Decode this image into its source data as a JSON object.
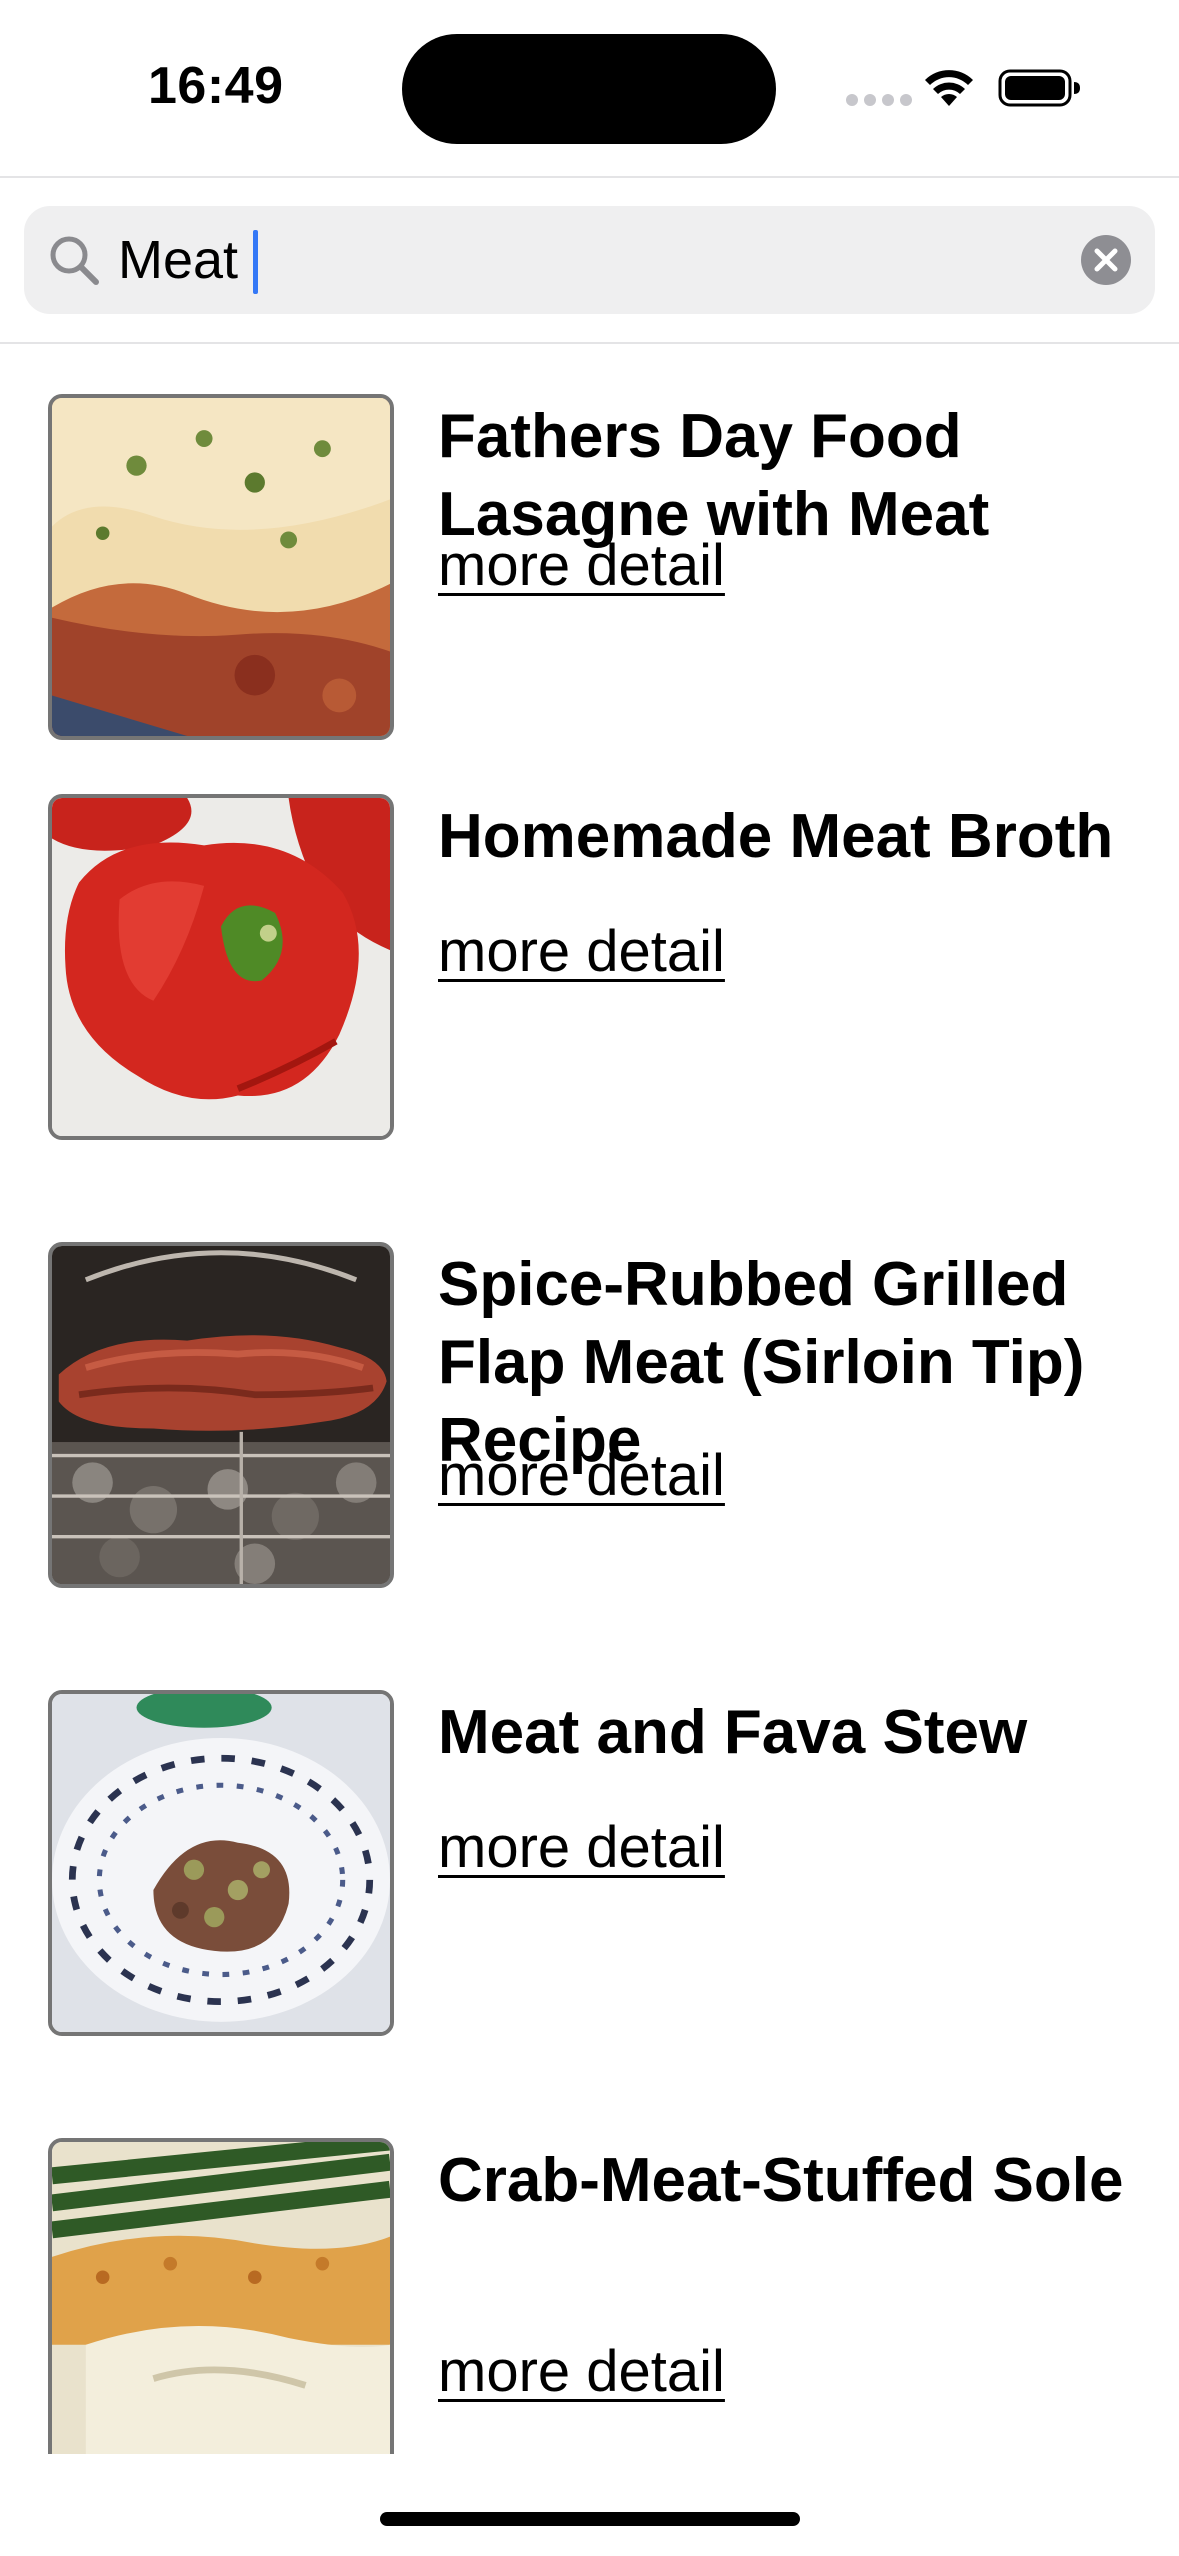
{
  "status_bar": {
    "time": "16:49"
  },
  "search": {
    "value": "Meat",
    "icon": "magnifier-icon",
    "clear_icon": "clear-circle-icon"
  },
  "results": [
    {
      "title": "Fathers Day Food Lasagne with Meat",
      "link": "more detail",
      "image": "lasagne-thumbnail"
    },
    {
      "title": "Homemade Meat Broth",
      "link": "more detail",
      "image": "red-pepper-thumbnail"
    },
    {
      "title": "Spice-Rubbed Grilled Flap Meat (Sirloin Tip) Recipe",
      "link": "more detail",
      "image": "grilled-meat-thumbnail"
    },
    {
      "title": "Meat and Fava Stew",
      "link": "more detail",
      "image": "stew-plate-thumbnail"
    },
    {
      "title": "Crab-Meat-Stuffed Sole",
      "link": "more detail",
      "image": "stuffed-sole-thumbnail"
    }
  ],
  "colors": {
    "accent_caret": "#3478f6",
    "search_background": "#efeff0",
    "thumbnail_border": "#757575"
  }
}
